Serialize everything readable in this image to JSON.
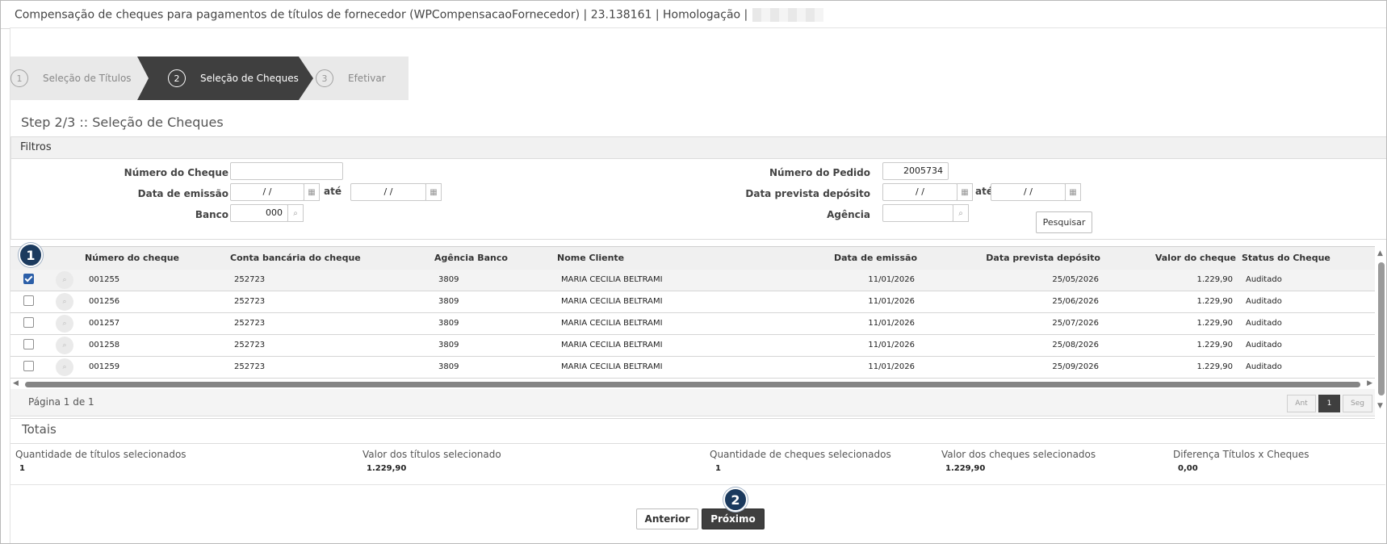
{
  "window": {
    "title": "Compensação de cheques para pagamentos de títulos de fornecedor (WPCompensacaoFornecedor) | 23.138161 | Homologação |"
  },
  "wizard": {
    "steps": [
      {
        "num": "1",
        "label": "Seleção de Títulos"
      },
      {
        "num": "2",
        "label": "Seleção de Cheques"
      },
      {
        "num": "3",
        "label": "Efetivar"
      }
    ],
    "active_step": 2,
    "step_title": "Step 2/3 :: Seleção de Cheques"
  },
  "filtros": {
    "title": "Filtros",
    "numero_cheque_label": "Número do Cheque",
    "numero_cheque_value": "",
    "data_emissao_label": "Data de emissão",
    "data_emissao_from": "/ /",
    "data_emissao_to": "/ /",
    "ate_label": "até",
    "banco_label": "Banco",
    "banco_value": "000",
    "numero_pedido_label": "Número do Pedido",
    "numero_pedido_value": "2005734",
    "data_prevista_label": "Data prevista depósito",
    "data_prevista_from": "/ /",
    "data_prevista_to": "/ /",
    "agencia_label": "Agência",
    "agencia_value": "",
    "pesquisar_label": "Pesquisar"
  },
  "grid": {
    "columns": [
      "Número do cheque",
      "Conta bancária do cheque",
      "Agência Banco",
      "Nome Cliente",
      "Data de emissão",
      "Data prevista depósito",
      "Valor do cheque",
      "Status do Cheque"
    ],
    "rows": [
      {
        "checked": true,
        "numero": "001255",
        "conta": "252723",
        "agencia": "3809",
        "cliente": "MARIA CECILIA BELTRAMI",
        "emissao": "11/01/2026",
        "prevista": "25/05/2026",
        "valor": "1.229,90",
        "status": "Auditado"
      },
      {
        "checked": false,
        "numero": "001256",
        "conta": "252723",
        "agencia": "3809",
        "cliente": "MARIA CECILIA BELTRAMI",
        "emissao": "11/01/2026",
        "prevista": "25/06/2026",
        "valor": "1.229,90",
        "status": "Auditado"
      },
      {
        "checked": false,
        "numero": "001257",
        "conta": "252723",
        "agencia": "3809",
        "cliente": "MARIA CECILIA BELTRAMI",
        "emissao": "11/01/2026",
        "prevista": "25/07/2026",
        "valor": "1.229,90",
        "status": "Auditado"
      },
      {
        "checked": false,
        "numero": "001258",
        "conta": "252723",
        "agencia": "3809",
        "cliente": "MARIA CECILIA BELTRAMI",
        "emissao": "11/01/2026",
        "prevista": "25/08/2026",
        "valor": "1.229,90",
        "status": "Auditado"
      },
      {
        "checked": false,
        "numero": "001259",
        "conta": "252723",
        "agencia": "3809",
        "cliente": "MARIA CECILIA BELTRAMI",
        "emissao": "11/01/2026",
        "prevista": "25/09/2026",
        "valor": "1.229,90",
        "status": "Auditado"
      }
    ],
    "pager_text": "Página 1 de 1",
    "pager_prev": "Ant",
    "pager_page": "1",
    "pager_next": "Seg"
  },
  "totais": {
    "title": "Totais",
    "items": [
      {
        "label": "Quantidade de títulos selecionados",
        "value": "1"
      },
      {
        "label": "Valor dos títulos selecionado",
        "value": "1.229,90"
      },
      {
        "label": "Quantidade de cheques selecionados",
        "value": "1"
      },
      {
        "label": "Valor dos cheques selecionados",
        "value": "1.229,90"
      },
      {
        "label": "Diferença Títulos x Cheques",
        "value": "0,00"
      }
    ]
  },
  "actions": {
    "anterior": "Anterior",
    "proximo": "Próximo"
  },
  "markers": {
    "m1": "1",
    "m2": "2"
  },
  "colors": {
    "accent_dark": "#3f3f3f",
    "marker": "#1b3a5e"
  },
  "icons": [
    "calendar-icon",
    "search-icon",
    "magnifier-icon"
  ]
}
